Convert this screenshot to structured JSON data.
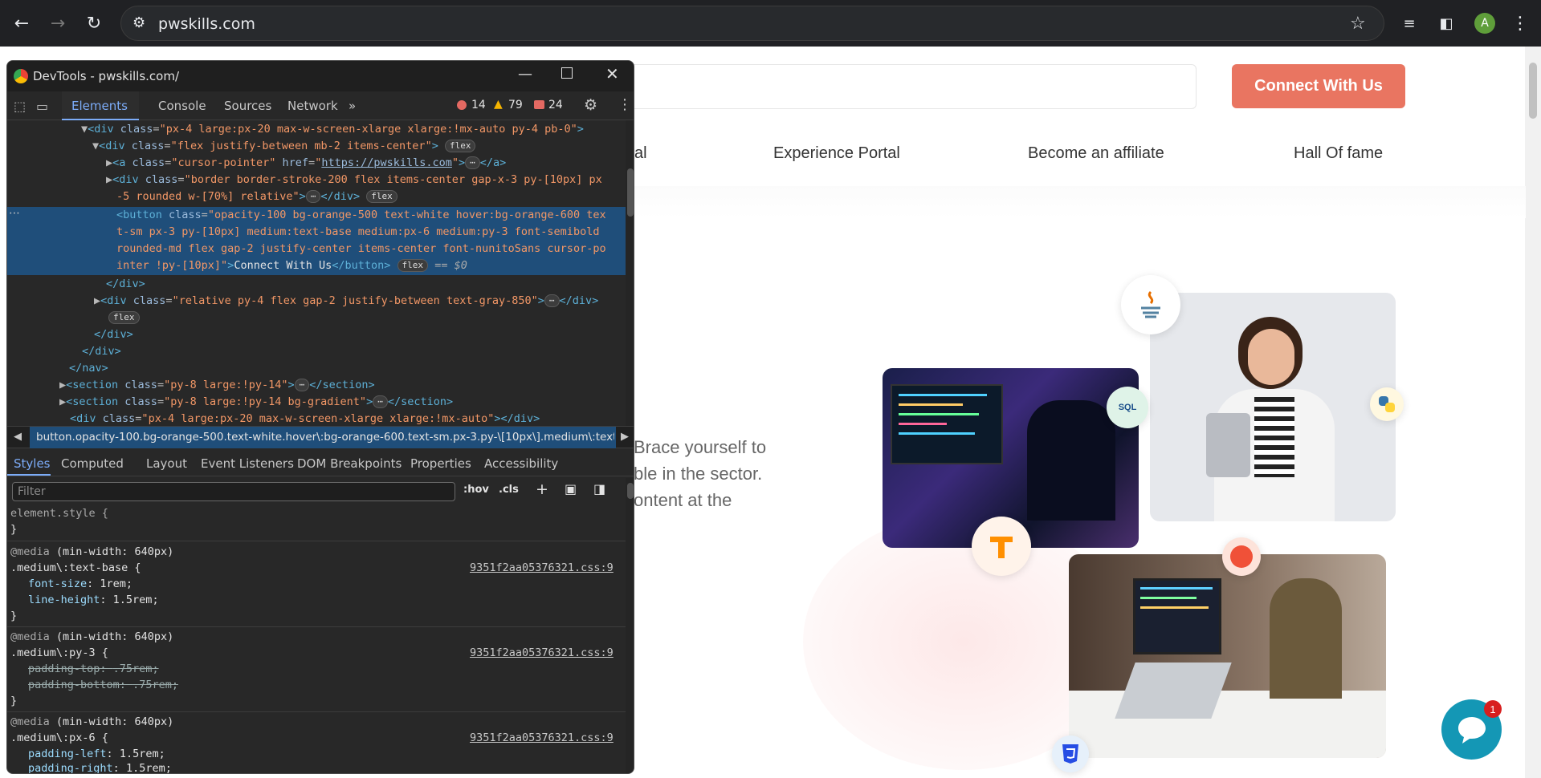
{
  "browser": {
    "url": "pwskills.com",
    "avatar_letter": "A"
  },
  "page": {
    "connect_button": "Connect With Us",
    "nav": [
      "al",
      "Experience Portal",
      "Become an affiliate",
      "Hall Of fame"
    ],
    "hero_lines": [
      "Brace yourself to",
      "ble in the sector.",
      "ontent at the"
    ],
    "chat_count": "1",
    "badges": {
      "sql": "SQL"
    }
  },
  "devtools": {
    "title": "DevTools - pwskills.com/",
    "tabs": [
      "Elements",
      "Console",
      "Sources",
      "Network"
    ],
    "counts": {
      "errors": "14",
      "warnings": "79",
      "issues": "24"
    },
    "breadcrumb": "button.opacity-100.bg-orange-500.text-white.hover\\:bg-orange-600.text-sm.px-3.py-\\[10px\\].medium\\:text-",
    "subtabs": [
      "Styles",
      "Computed",
      "Layout",
      "Event Listeners",
      "DOM Breakpoints",
      "Properties",
      "Accessibility"
    ],
    "filter_placeholder": "Filter",
    "hov": ":hov",
    "cls": ".cls",
    "flex": "flex",
    "dom": {
      "l1_class": "px-4 large:px-20 max-w-screen-xlarge xlarge:!mx-auto py-4 pb-0",
      "l2_class": "flex justify-between mb-2 items-center",
      "l3_class": "cursor-pointer",
      "l3_href": "https://pwskills.com",
      "l4_class_a": "border border-stroke-200 flex items-center gap-x-3 py-[10px] px",
      "l4_class_b": "-5 rounded w-[70%] relative",
      "btn_a": "opacity-100 bg-orange-500 text-white hover:bg-orange-600 tex",
      "btn_b": "t-sm px-3 py-[10px] medium:text-base medium:px-6 medium:py-3 font-semibold",
      "btn_c": "rounded-md flex gap-2 justify-center items-center font-nunitoSans cursor-po",
      "btn_d": "inter !py-[10px]",
      "btn_text": "Connect With Us",
      "dollar0": "== $0",
      "l6_class": "relative py-4 flex gap-2 justify-between text-gray-850",
      "s1_class": "py-8 large:!py-14",
      "s2_class": "py-8 large:!py-14 bg-gradient",
      "l9_class": "px-4 large:px-20 max-w-screen-xlarge xlarge:!mx-auto"
    },
    "styles": {
      "element_style": "element.style {",
      "media": "@media",
      "media_cond": "(min-width: 640px)",
      "r1_sel": ".medium\\:text-base {",
      "r1_p1": "font-size",
      "r1_v1": "1rem;",
      "r1_p2": "line-height",
      "r1_v2": "1.5rem;",
      "r2_sel": ".medium\\:py-3 {",
      "r2_p1": "padding-top",
      "r2_v1": ".75rem;",
      "r2_p2": "padding-bottom",
      "r2_v2": ".75rem;",
      "r3_sel": ".medium\\:px-6 {",
      "r3_p1": "padding-left",
      "r3_v1": "1.5rem;",
      "r3_p2": "padding-right",
      "r3_v2": "1.5rem;",
      "source": "9351f2aa05376321.css:9"
    }
  },
  "colors": {
    "accent": "#e97561",
    "chat": "#1497b5",
    "selection": "#1f4e7a"
  }
}
